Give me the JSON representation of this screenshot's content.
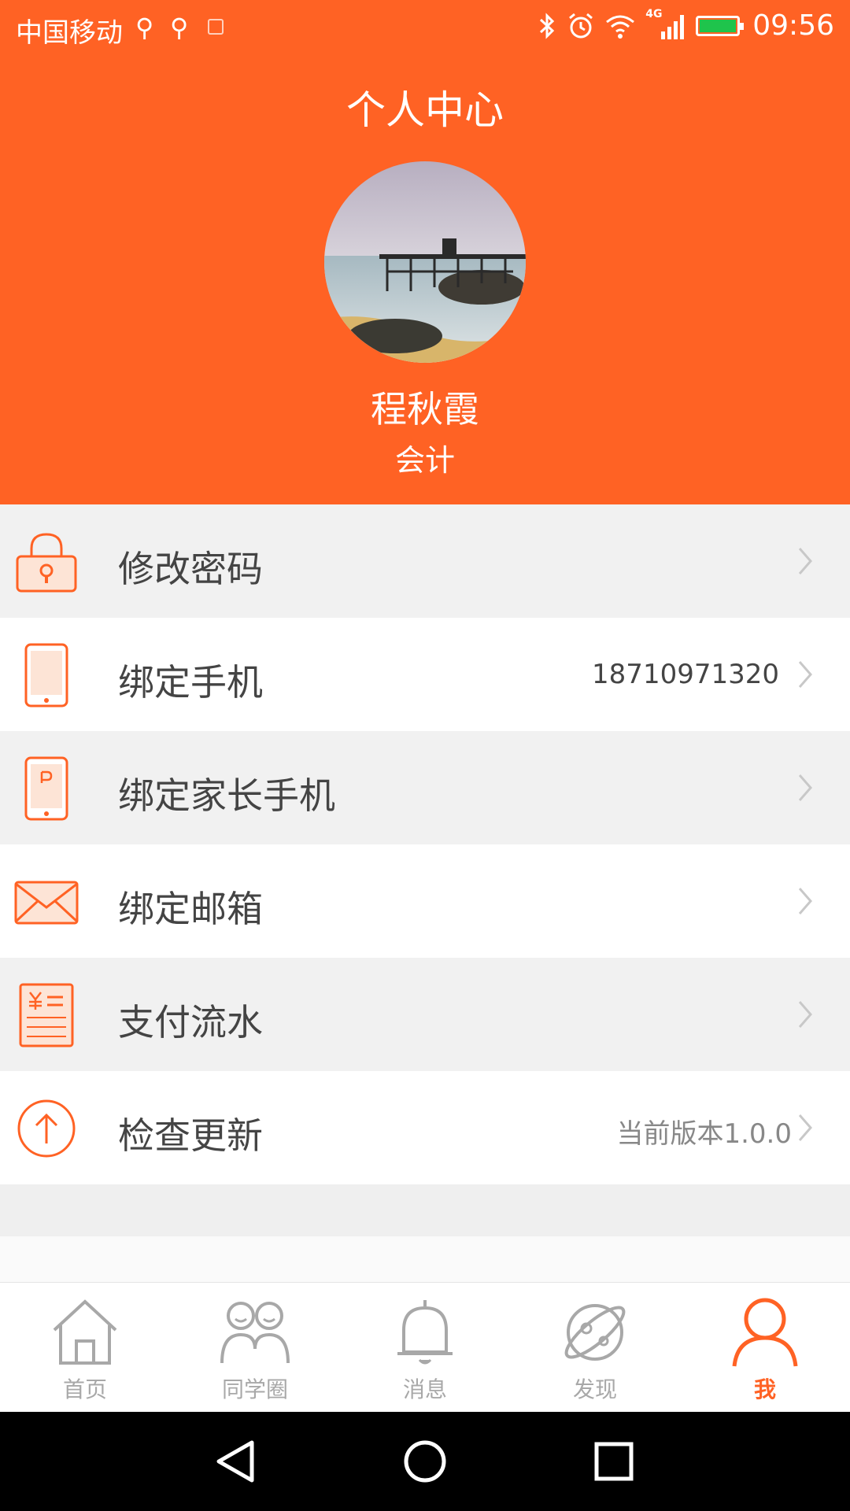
{
  "status_bar": {
    "carrier": "中国移动",
    "network": "4G",
    "time": "09:56"
  },
  "header": {
    "title": "个人中心",
    "user_name": "程秋霞",
    "user_role": "会计"
  },
  "menu": [
    {
      "label": "修改密码",
      "value": "",
      "icon": "lock-icon"
    },
    {
      "label": "绑定手机",
      "value": "18710971320",
      "icon": "phone-icon"
    },
    {
      "label": "绑定家长手机",
      "value": "",
      "icon": "parent-phone-icon"
    },
    {
      "label": "绑定邮箱",
      "value": "",
      "icon": "mail-icon"
    },
    {
      "label": "支付流水",
      "value": "",
      "icon": "payment-record-icon"
    },
    {
      "label": "检查更新",
      "value": "当前版本1.0.0",
      "icon": "update-icon"
    }
  ],
  "bottom_nav": [
    {
      "label": "首页",
      "icon": "home-icon",
      "active": false
    },
    {
      "label": "同学圈",
      "icon": "classmates-icon",
      "active": false
    },
    {
      "label": "消息",
      "icon": "bell-icon",
      "active": false
    },
    {
      "label": "发现",
      "icon": "planet-icon",
      "active": false
    },
    {
      "label": "我",
      "icon": "person-icon",
      "active": true
    }
  ],
  "colors": {
    "accent": "#ff6224",
    "inactive": "#a8a8a8",
    "text": "#444444"
  }
}
